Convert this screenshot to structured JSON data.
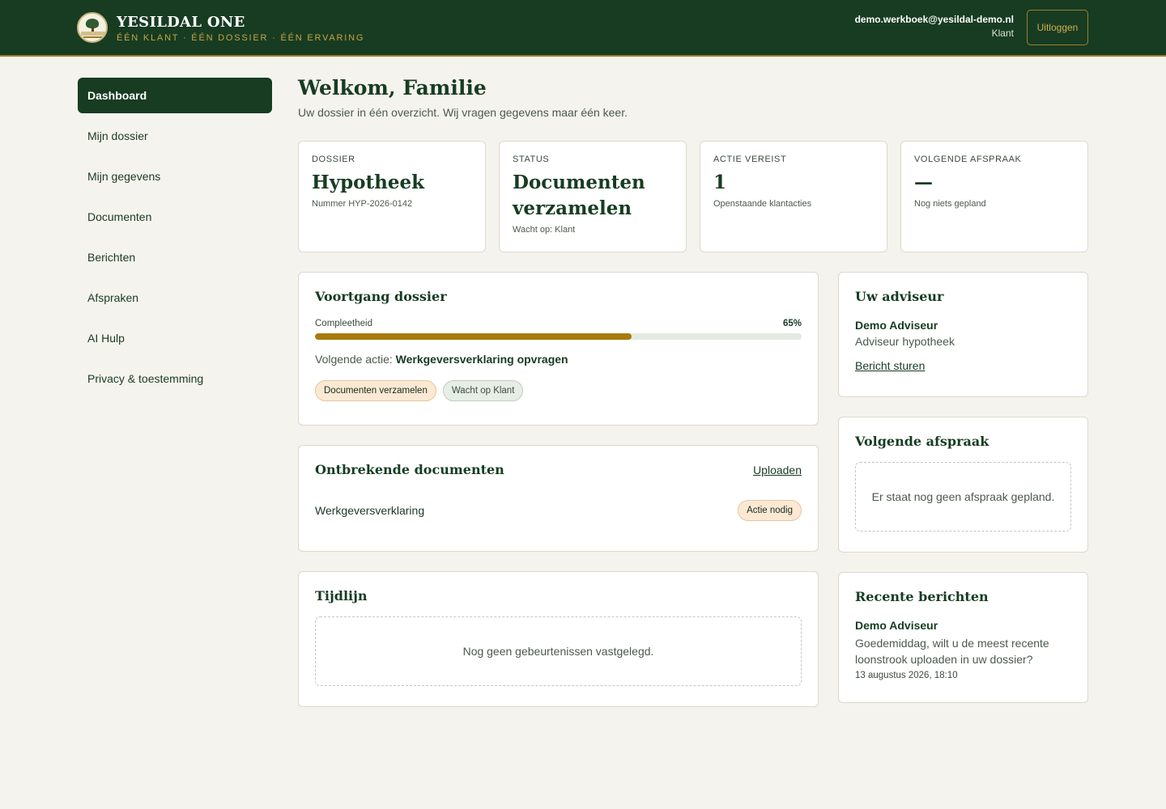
{
  "header": {
    "brand_title": "YESILDAL ONE",
    "brand_tagline": "ÉÉN KLANT · ÉÉN DOSSIER · ÉÉN ERVARING",
    "user_email": "demo.werkboek@yesildal-demo.nl",
    "user_role": "Klant",
    "logout_label": "Uitloggen"
  },
  "sidebar": {
    "items": [
      {
        "label": "Dashboard",
        "active": true
      },
      {
        "label": "Mijn dossier"
      },
      {
        "label": "Mijn gegevens"
      },
      {
        "label": "Documenten"
      },
      {
        "label": "Berichten"
      },
      {
        "label": "Afspraken"
      },
      {
        "label": "AI Hulp"
      },
      {
        "label": "Privacy & toestemming"
      }
    ]
  },
  "main": {
    "title": "Welkom, Familie",
    "subtitle": "Uw dossier in één overzicht. Wij vragen gegevens maar één keer."
  },
  "stats": [
    {
      "label": "DOSSIER",
      "value": "Hypotheek",
      "sub": "Nummer HYP-2026-0142"
    },
    {
      "label": "STATUS",
      "value": "Documenten verzamelen",
      "sub": "Wacht op: Klant"
    },
    {
      "label": "ACTIE VEREIST",
      "value": "1",
      "sub": "Openstaande klantacties"
    },
    {
      "label": "VOLGENDE AFSPRAAK",
      "value": "—",
      "sub": "Nog niets gepland"
    }
  ],
  "progress": {
    "title": "Voortgang dossier",
    "label": "Compleetheid",
    "percent_label": "65%",
    "percent": 65,
    "next_action_label": "Volgende actie:",
    "next_action_value": "Werkgeversverklaring opvragen",
    "badges": [
      "Documenten verzamelen",
      "Wacht op Klant"
    ]
  },
  "missing_docs": {
    "title": "Ontbrekende documenten",
    "upload_label": "Uploaden",
    "items": [
      {
        "name": "Werkgeversverklaring",
        "badge": "Actie nodig"
      }
    ]
  },
  "timeline": {
    "title": "Tijdlijn",
    "empty_text": "Nog geen gebeurtenissen vastgelegd."
  },
  "advisor": {
    "title": "Uw adviseur",
    "name": "Demo Adviseur",
    "role": "Adviseur hypotheek",
    "message_link": "Bericht sturen"
  },
  "appointment": {
    "title": "Volgende afspraak",
    "empty_text": "Er staat nog geen afspraak gepland."
  },
  "messages": {
    "title": "Recente berichten",
    "items": [
      {
        "sender": "Demo Adviseur",
        "text": "Goedemiddag, wilt u de meest recente loonstrook uploaden in uw dossier?",
        "time": "13 augustus 2026, 18:10"
      }
    ]
  },
  "colors": {
    "brand_dark": "#173c22",
    "accent_gold": "#a87a0f",
    "background": "#f5f3ed"
  }
}
